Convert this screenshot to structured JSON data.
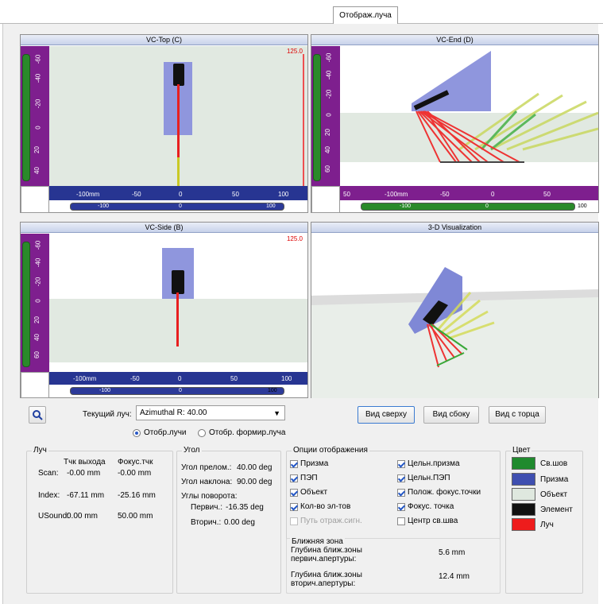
{
  "tab": {
    "label": "Отображ.луча"
  },
  "views": {
    "top": {
      "title": "VC-Top (C)",
      "value": "125.0"
    },
    "end": {
      "title": "VC-End (D)"
    },
    "side": {
      "title": "VC-Side (B)",
      "value": "125.0"
    },
    "viz3d": {
      "title": "3-D Visualization"
    }
  },
  "rulers": {
    "top_h": [
      "-100mm",
      "-50",
      "0",
      "50",
      "100"
    ],
    "top_scroll": [
      "-100",
      "0",
      "100"
    ],
    "top_v": [
      "-60",
      "-40",
      "-20",
      "0",
      "20",
      "40"
    ],
    "end_h": [
      "50",
      "-100mm",
      "-50",
      "0",
      "50"
    ],
    "end_scroll": [
      "-100",
      "0",
      "100"
    ],
    "end_v": [
      "-60",
      "-40",
      "-20",
      "0",
      "20",
      "40",
      "60"
    ],
    "side_h": [
      "-100mm",
      "-50",
      "0",
      "50",
      "100"
    ],
    "side_scroll": [
      "-100",
      "0",
      "100"
    ],
    "side_v": [
      "-60",
      "-40",
      "-20",
      "0",
      "20",
      "40",
      "60"
    ]
  },
  "controls": {
    "current_beam_label": "Текущий луч:",
    "current_beam_value": "Azimuthal   R: 40.00",
    "radio_beams": "Отобр.лучи",
    "radio_forming": "Отобр. формир.луча",
    "btn_top": "Вид сверху",
    "btn_side": "Вид сбоку",
    "btn_end": "Вид с торца"
  },
  "beam": {
    "title": "Луч",
    "col_exit": "Тчк выхода",
    "col_focus": "Фокус.тчк",
    "rows": [
      {
        "label": "Scan:",
        "exit": "-0.00 mm",
        "focus": "-0.00 mm"
      },
      {
        "label": "Index:",
        "exit": "-67.11 mm",
        "focus": "-25.16 mm"
      },
      {
        "label": "USound:",
        "exit": "0.00 mm",
        "focus": "50.00 mm"
      }
    ]
  },
  "angle": {
    "title": "Угол",
    "refraction_label": "Угол прелом.:",
    "refraction_value": "40.00 deg",
    "tilt_label": "Угол наклона:",
    "tilt_value": "90.00 deg",
    "rotation_label": "Углы поворота:",
    "primary_label": "Первич.:",
    "primary_value": "-16.35 deg",
    "secondary_label": "Вторич.:",
    "secondary_value": "0.00 deg"
  },
  "options": {
    "title": "Опции отображения",
    "items": [
      {
        "label": "Призма",
        "checked": true,
        "enabled": true
      },
      {
        "label": "ПЭП",
        "checked": true,
        "enabled": true
      },
      {
        "label": "Объект",
        "checked": true,
        "enabled": true
      },
      {
        "label": "Кол-во эл-тов",
        "checked": true,
        "enabled": true
      },
      {
        "label": "Путь отраж.сигн.",
        "checked": false,
        "enabled": false
      },
      {
        "label": "Цельн.призма",
        "checked": true,
        "enabled": true
      },
      {
        "label": "Цельн.ПЭП",
        "checked": true,
        "enabled": true
      },
      {
        "label": "Полож. фокус.точки",
        "checked": true,
        "enabled": true
      },
      {
        "label": "Фокус. точка",
        "checked": true,
        "enabled": true
      },
      {
        "label": "Центр св.шва",
        "checked": false,
        "enabled": true
      }
    ]
  },
  "nearzone": {
    "title": "Ближняя зона",
    "primary_label": "Глубина ближ.зоны первич.апертуры:",
    "primary_value": "5.6 mm",
    "secondary_label": "Глубина ближ.зоны вторич.апертуры:",
    "secondary_value": "12.4 mm"
  },
  "colors": {
    "title": "Цвет",
    "items": [
      {
        "label": "Св.шов",
        "hex": "#1f8a2e"
      },
      {
        "label": "Призма",
        "hex": "#3f4fb0"
      },
      {
        "label": "Объект",
        "hex": "#dfe8df"
      },
      {
        "label": "Элемент",
        "hex": "#111111"
      },
      {
        "label": "Луч",
        "hex": "#ee1c1c"
      }
    ]
  }
}
